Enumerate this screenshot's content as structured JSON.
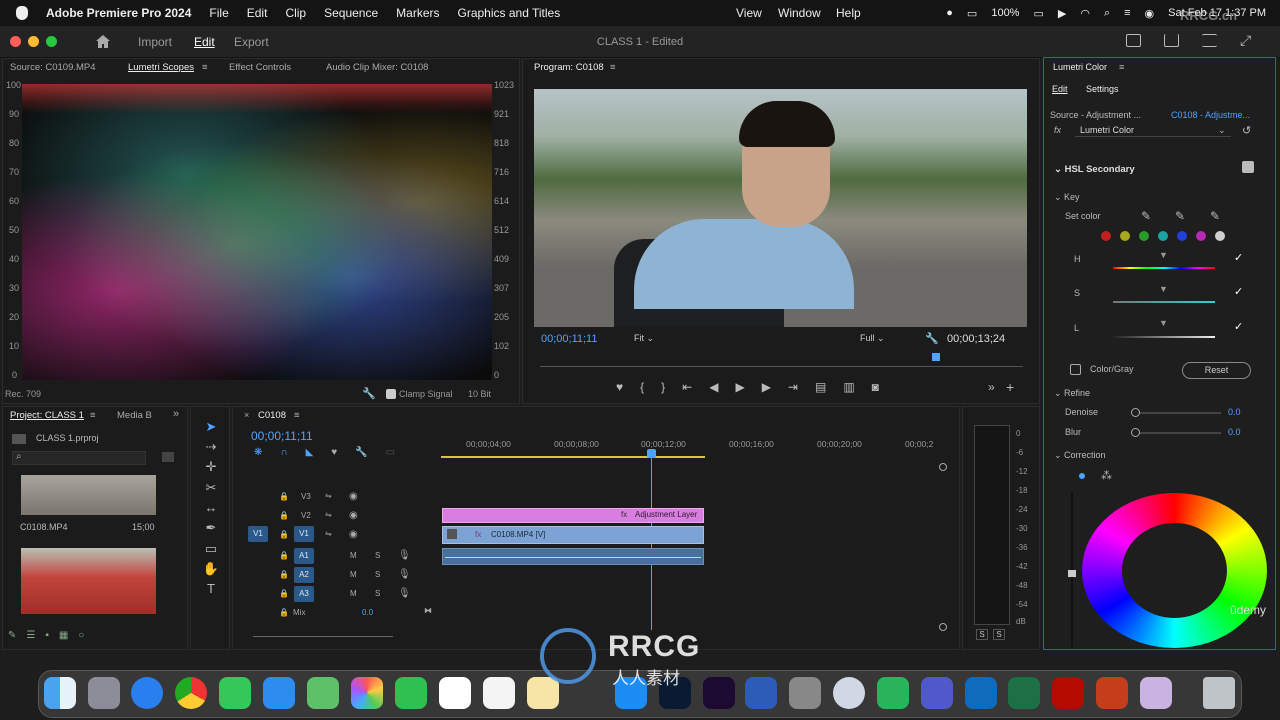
{
  "menubar": {
    "app": "Adobe Premiere Pro 2024",
    "menus": [
      "File",
      "Edit",
      "Clip",
      "Sequence",
      "Markers",
      "Graphics and Titles"
    ],
    "right_menus": [
      "View",
      "Window",
      "Help"
    ],
    "battery": "100%",
    "datetime": "Sat Feb 17  1:37 PM"
  },
  "header": {
    "workspaces": [
      "Import",
      "Edit",
      "Export"
    ],
    "doc_title": "CLASS 1 - Edited"
  },
  "source_panel": {
    "tabs": [
      "Source: C0109.MP4",
      "Lumetri Scopes",
      "Effect Controls",
      "Audio Clip Mixer: C0108"
    ],
    "left_scale": [
      "100",
      "90",
      "80",
      "70",
      "60",
      "50",
      "40",
      "30",
      "20",
      "10",
      "0"
    ],
    "right_scale": [
      "1023",
      "921",
      "818",
      "716",
      "614",
      "512",
      "409",
      "307",
      "205",
      "102",
      "0"
    ],
    "footer_left": "Rec. 709",
    "clamp_label": "Clamp Signal",
    "bit_depth": "10 Bit"
  },
  "program": {
    "title": "Program: C0108",
    "timecode_in": "00;00;11;11",
    "fit": "Fit",
    "quality": "Full",
    "timecode_dur": "00;00;13;24"
  },
  "project": {
    "tabs": [
      "Project: CLASS 1",
      "Media B"
    ],
    "file": "CLASS 1.prproj",
    "clip1_name": "C0108.MP4",
    "clip1_dur": "15;00"
  },
  "timeline": {
    "sequence": "C0108",
    "timecode": "00;00;11;11",
    "ruler": [
      "00;00;04;00",
      "00;00;08;00",
      "00;00;12;00",
      "00;00;16;00",
      "00;00;20;00",
      "00;00;2"
    ],
    "video_tracks": [
      "V3",
      "V2",
      "V1"
    ],
    "audio_tracks": [
      "A1",
      "A2",
      "A3"
    ],
    "mix_label": "Mix",
    "mix_value": "0.0",
    "adjustment_clip": "Adjustment Layer",
    "video_clip": "C0108.MP4 [V]",
    "src_patch": "V1"
  },
  "meter": {
    "scale": [
      "0",
      "-6",
      "-12",
      "-18",
      "-24",
      "-30",
      "-36",
      "-42",
      "-48",
      "-54",
      "dB"
    ],
    "solo": [
      "S",
      "S"
    ]
  },
  "lumetri": {
    "title": "Lumetri Color",
    "tabs": [
      "Edit",
      "Settings"
    ],
    "source": "Source - Adjustment ...",
    "target": "C0108 - Adjustme...",
    "fx_label": "Lumetri Color",
    "section": "HSL Secondary",
    "key": "Key",
    "set_color": "Set color",
    "h": "H",
    "s": "S",
    "l": "L",
    "color_gray": "Color/Gray",
    "reset": "Reset",
    "refine": "Refine",
    "denoise": "Denoise",
    "denoise_val": "0.0",
    "blur": "Blur",
    "blur_val": "0.0",
    "correction": "Correction",
    "swatches": [
      "#c0201f",
      "#a8a81c",
      "#2a9a2a",
      "#1aa3a3",
      "#2340d8",
      "#b52ab5",
      "#cfcfcf"
    ]
  },
  "watermark": {
    "brand": "RRCG",
    "sub": "人人素材",
    "corner": "RRCG.cn",
    "udemy": "ûdemy"
  }
}
